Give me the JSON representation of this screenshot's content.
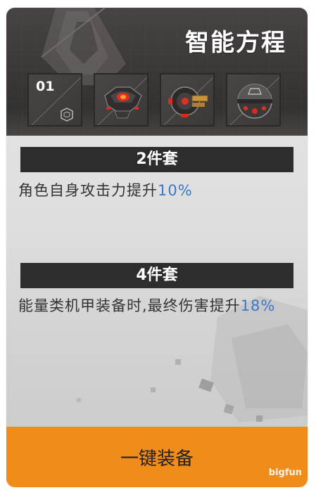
{
  "title": "智能方程",
  "slots": [
    {
      "number": "01",
      "icon": "hexagon-emblem-icon"
    },
    {
      "icon": "mech-core-icon"
    },
    {
      "icon": "mech-engine-icon"
    },
    {
      "icon": "mech-orb-icon"
    }
  ],
  "set_bonuses": [
    {
      "header": "2件套",
      "desc_text": "角色自身攻击力提升",
      "desc_value": "10%"
    },
    {
      "header": "4件套",
      "desc_text": "能量类机甲装备时,最终伤害提升",
      "desc_value": "18%"
    }
  ],
  "equip_button_label": "一键装备",
  "watermark": "bigfun",
  "colors": {
    "accent_orange": "#f08c1a",
    "highlight_blue": "#3a78c9",
    "header_dark": "#2d2d2d"
  }
}
